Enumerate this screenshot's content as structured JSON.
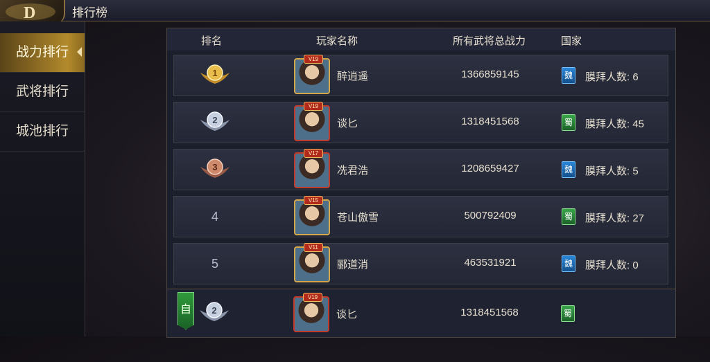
{
  "window": {
    "title": "排行榜",
    "logo": "D"
  },
  "sidebar": {
    "items": [
      {
        "label": "战力排行",
        "active": true
      },
      {
        "label": "武将排行",
        "active": false
      },
      {
        "label": "城池排行",
        "active": false
      }
    ]
  },
  "table": {
    "headers": {
      "rank": "排名",
      "player": "玩家名称",
      "power": "所有武将总战力",
      "country": "国家"
    },
    "rows": [
      {
        "rank": "1",
        "medal": "gold-medal",
        "vip": "V19",
        "name": "醉逍遥",
        "power": "1366859145",
        "country": "魏",
        "worship_label": "膜拜人数:",
        "worship_count": "6"
      },
      {
        "rank": "2",
        "medal": "silver-medal",
        "vip": "V19",
        "name": "谈匕",
        "power": "1318451568",
        "country": "蜀",
        "worship_label": "膜拜人数:",
        "worship_count": "45"
      },
      {
        "rank": "3",
        "medal": "bronze-medal",
        "vip": "V17",
        "name": "冼君浩",
        "power": "1208659427",
        "country": "魏",
        "worship_label": "膜拜人数:",
        "worship_count": "5"
      },
      {
        "rank": "4",
        "medal": "",
        "vip": "V15",
        "name": "苍山傲雪",
        "power": "500792409",
        "country": "蜀",
        "worship_label": "膜拜人数:",
        "worship_count": "27"
      },
      {
        "rank": "5",
        "medal": "",
        "vip": "V11",
        "name": "郦道消",
        "power": "463531921",
        "country": "魏",
        "worship_label": "膜拜人数:",
        "worship_count": "0"
      }
    ],
    "self_row": {
      "tag": "自己",
      "rank": "2",
      "medal": "silver-medal",
      "vip": "V19",
      "name": "谈匕",
      "power": "1318451568",
      "country": "蜀"
    }
  },
  "colors": {
    "gold": "#d9a93a",
    "silver": "#a9b4c9",
    "bronze": "#b8745a",
    "wei": "#2a86d8",
    "shu": "#3aa54a",
    "active_tab": "#b38a2c"
  }
}
